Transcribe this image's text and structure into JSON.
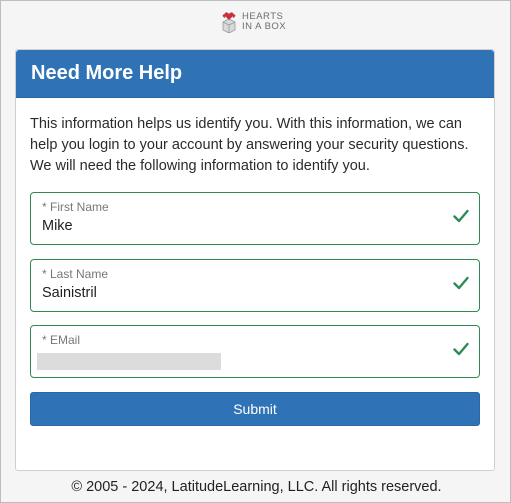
{
  "logo": {
    "line1": "HEARTS",
    "line2": "IN A BOX",
    "icon": "heart-box-icon"
  },
  "card": {
    "title": "Need More Help",
    "intro": "This information helps us identify you. With this information, we can help you login to your account by answering your security questions. We will need the following information to identify you."
  },
  "fields": {
    "first_name": {
      "label": "* First Name",
      "value": "Mike",
      "status_icon": "check-icon"
    },
    "last_name": {
      "label": "* Last Name",
      "value": "Sainistril",
      "status_icon": "check-icon"
    },
    "email": {
      "label": "* EMail",
      "value": "",
      "status_icon": "check-icon"
    }
  },
  "actions": {
    "submit_label": "Submit"
  },
  "footer": {
    "copyright": "© 2005 - 2024, LatitudeLearning, LLC. All rights reserved."
  },
  "colors": {
    "primary": "#2f73b6",
    "valid_border": "#2f8a50",
    "check": "#2e8b57"
  }
}
